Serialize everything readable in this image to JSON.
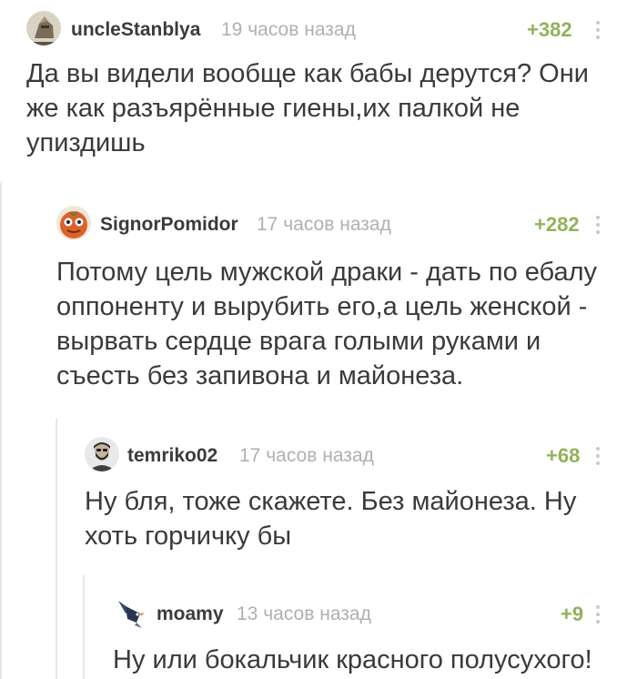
{
  "comments": [
    {
      "username": "uncleStanblya",
      "time": "19 часов назад",
      "rating": "+382",
      "avatar_icon": "knight-avatar-icon",
      "text": "Да вы видели вообще как бабы дерутся? Они\nже как разъярённые гиены,их палкой не\nупиздишь"
    },
    {
      "username": "SignorPomidor",
      "time": "17 часов назад",
      "rating": "+282",
      "avatar_icon": "tomato-face-avatar-icon",
      "text": "Потому цель мужской драки - дать по ебалу\nоппоненту и вырубить его,а цель женской -\nвырвать сердце врага голыми руками и\nсъесть без запивона и майонеза."
    },
    {
      "username": "temriko02",
      "time": "17 часов назад",
      "rating": "+68",
      "avatar_icon": "bearded-man-avatar-icon",
      "text": "Ну бля, тоже скажете. Без майонеза. Ну\nхоть горчичку бы"
    },
    {
      "username": "moamy",
      "time": "13 часов назад",
      "rating": "+9",
      "avatar_icon": "bird-avatar-icon",
      "text": "Ну или бокальчик красного полусухого!"
    }
  ],
  "colors": {
    "rating": "#8fb35a",
    "username": "#3b3b3b",
    "time": "#b0b0b0",
    "thread_line": "#e6e6e6"
  }
}
